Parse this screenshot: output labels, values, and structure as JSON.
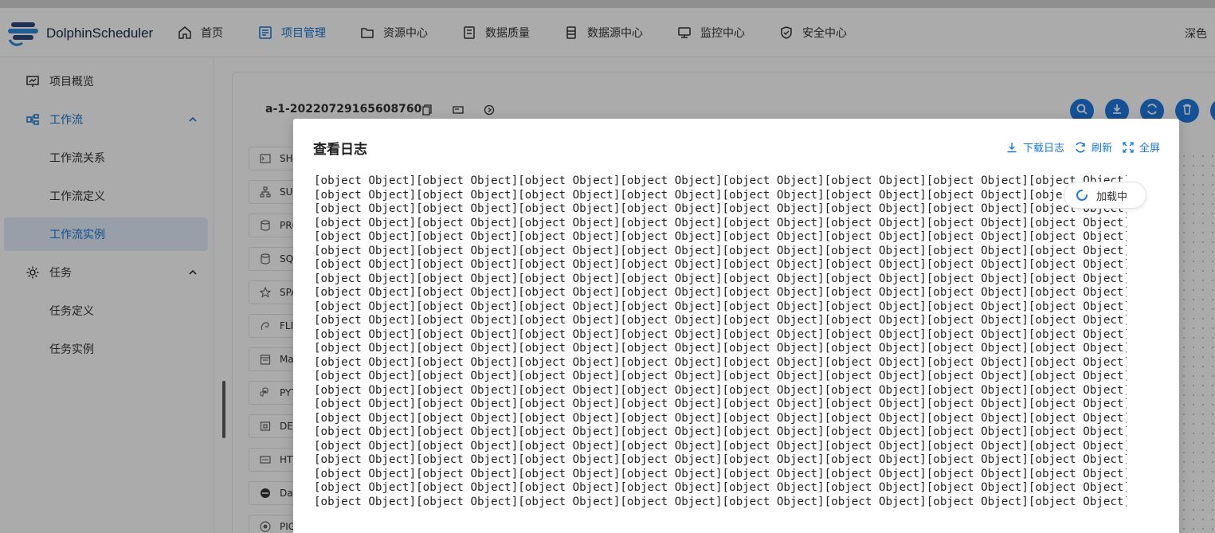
{
  "app": {
    "brand": "DolphinScheduler",
    "theme_label": "深色"
  },
  "nav": {
    "items": [
      {
        "label": "首页",
        "icon": "home-icon"
      },
      {
        "label": "项目管理",
        "icon": "project-icon",
        "active": true
      },
      {
        "label": "资源中心",
        "icon": "folder-icon"
      },
      {
        "label": "数据质量",
        "icon": "data-quality-icon"
      },
      {
        "label": "数据源中心",
        "icon": "datasource-icon"
      },
      {
        "label": "监控中心",
        "icon": "monitor-icon"
      },
      {
        "label": "安全中心",
        "icon": "shield-icon"
      }
    ]
  },
  "sidebar": {
    "items": [
      {
        "label": "项目概览",
        "icon": "overview-icon"
      },
      {
        "label": "工作流",
        "icon": "workflow-icon",
        "expanded": true
      },
      {
        "label": "工作流关系"
      },
      {
        "label": "工作流定义"
      },
      {
        "label": "工作流实例",
        "selected": true
      },
      {
        "label": "任务",
        "icon": "gear-icon",
        "expanded": true
      },
      {
        "label": "任务定义"
      },
      {
        "label": "任务实例"
      }
    ]
  },
  "workflow": {
    "title": "a-1-20220729165608760",
    "task_types": [
      "SHELL",
      "SUB_PROCESS",
      "PROCEDURE",
      "SQL",
      "SPARK",
      "FLINK",
      "MapReduce",
      "PYTHON",
      "DEPENDENT",
      "HTTP",
      "DataX",
      "PIGEON"
    ]
  },
  "modal": {
    "title": "查看日志",
    "download_label": "下载日志",
    "refresh_label": "刷新",
    "fullscreen_label": "全屏",
    "loading_label": "加载中",
    "log_text": "[object Object][object Object][object Object][object Object][object Object][object Object][object Object][object Object]\n[object Object][object Object][object Object][object Object][object Object][object Object][object Object][object Object]\n[object Object][object Object][object Object][object Object][object Object][object Object][object Object][object Object]\n[object Object][object Object][object Object][object Object][object Object][object Object][object Object][object Object]\n[object Object][object Object][object Object][object Object][object Object][object Object][object Object][object Object]\n[object Object][object Object][object Object][object Object][object Object][object Object][object Object][object Object]\n[object Object][object Object][object Object][object Object][object Object][object Object][object Object][object Object]\n[object Object][object Object][object Object][object Object][object Object][object Object][object Object][object Object]\n[object Object][object Object][object Object][object Object][object Object][object Object][object Object][object Object]\n[object Object][object Object][object Object][object Object][object Object][object Object][object Object][object Object]\n[object Object][object Object][object Object][object Object][object Object][object Object][object Object][object Object]\n[object Object][object Object][object Object][object Object][object Object][object Object][object Object][object Object]\n[object Object][object Object][object Object][object Object][object Object][object Object][object Object][object Object]\n[object Object][object Object][object Object][object Object][object Object][object Object][object Object][object Object]\n[object Object][object Object][object Object][object Object][object Object][object Object][object Object][object Object]\n[object Object][object Object][object Object][object Object][object Object][object Object][object Object][object Object]\n[object Object][object Object][object Object][object Object][object Object][object Object][object Object][object Object]\n[object Object][object Object][object Object][object Object][object Object][object Object][object Object][object Object]\n[object Object][object Object][object Object][object Object][object Object][object Object][object Object][object Object]\n[object Object][object Object][object Object][object Object][object Object][object Object][object Object][object Object]\n[object Object][object Object][object Object][object Object][object Object][object Object][object Object][object Object]\n[object Object][object Object][object Object][object Object][object Object][object Object][object Object][object Object]\n[object Object][object Object][object Object][object Object][object Object][object Object][object Object][object Object]\n[object Object][object Object][object Object][object Object][object Object][object Object][object Object][object Object]"
  },
  "colors": {
    "accent": "#1677d3",
    "overlay": "rgba(0,0,0,0.33)",
    "toolbar_button": "#1f7ae0"
  }
}
